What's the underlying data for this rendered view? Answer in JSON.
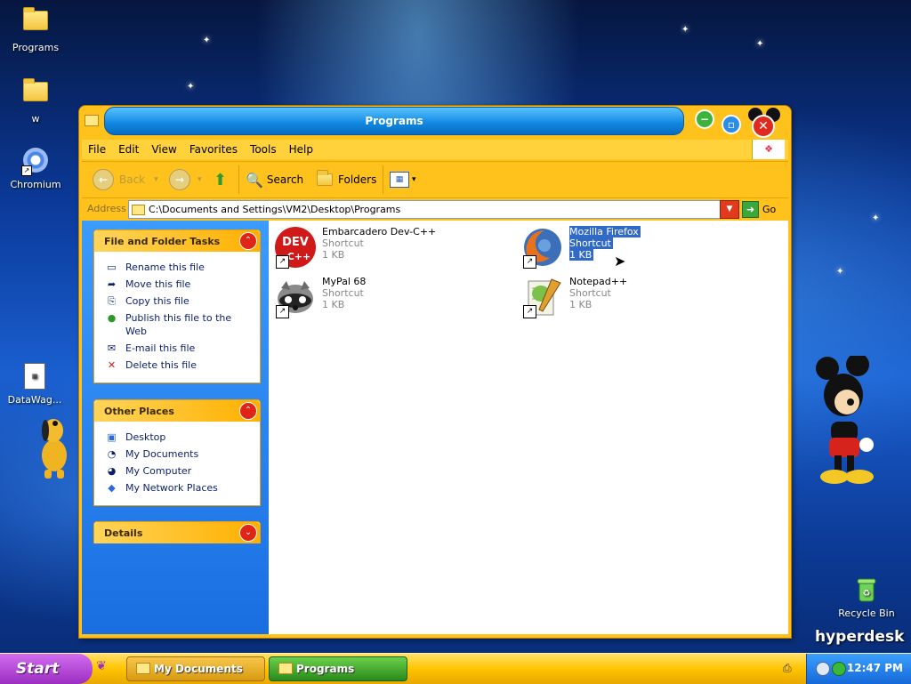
{
  "desktop": {
    "icons": [
      {
        "label": "Programs",
        "icon": "folder-icon"
      },
      {
        "label": "w",
        "icon": "folder-icon"
      },
      {
        "label": "Chromium",
        "icon": "chromium-icon"
      },
      {
        "label": "DataWag...",
        "icon": "document-icon"
      },
      {
        "label": "Recycle Bin",
        "icon": "recycle-bin-icon"
      }
    ],
    "brand": "hyperdesk"
  },
  "window": {
    "title": "Programs",
    "menu": [
      "File",
      "Edit",
      "View",
      "Favorites",
      "Tools",
      "Help"
    ],
    "toolbar": {
      "back": "Back",
      "search": "Search",
      "folders": "Folders"
    },
    "address": {
      "label": "Address",
      "value": "C:\\Documents and Settings\\VM2\\Desktop\\Programs",
      "go": "Go"
    },
    "panels": {
      "file_tasks": {
        "title": "File and Folder Tasks",
        "items": [
          "Rename this file",
          "Move this file",
          "Copy this file",
          "Publish this file to the Web",
          "E-mail this file",
          "Delete this file"
        ]
      },
      "other_places": {
        "title": "Other Places",
        "items": [
          "Desktop",
          "My Documents",
          "My Computer",
          "My Network Places"
        ]
      },
      "details": {
        "title": "Details"
      }
    },
    "files": [
      {
        "name": "Embarcadero Dev-C++",
        "type": "Shortcut",
        "size": "1 KB",
        "icon": "devcpp-icon"
      },
      {
        "name": "Mozilla Firefox",
        "type": "Shortcut",
        "size": "1 KB",
        "icon": "firefox-icon",
        "selected": true
      },
      {
        "name": "MyPal 68",
        "type": "Shortcut",
        "size": "1 KB",
        "icon": "mypal-icon"
      },
      {
        "name": "Notepad++",
        "type": "Shortcut",
        "size": "1 KB",
        "icon": "notepadpp-icon"
      }
    ]
  },
  "taskbar": {
    "start": "Start",
    "tasks": [
      {
        "label": "My Documents"
      },
      {
        "label": "Programs"
      }
    ],
    "clock": "12:47 PM"
  }
}
